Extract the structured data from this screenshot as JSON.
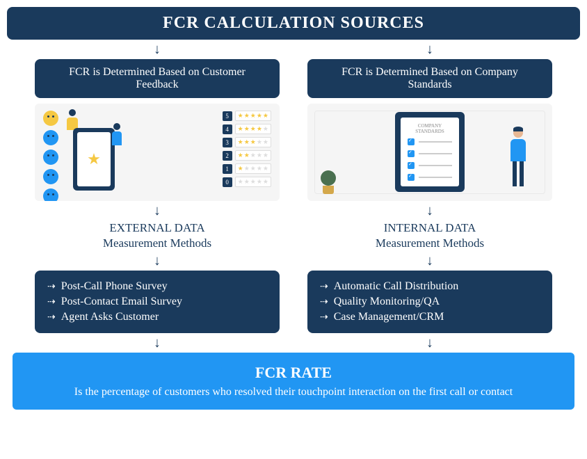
{
  "title": "FCR CALCULATION SOURCES",
  "left": {
    "source": "FCR is Determined Based on Customer Feedback",
    "heading_line1": "EXTERNAL DATA",
    "heading_line2": "Measurement Methods",
    "methods": [
      "Post-Call Phone Survey",
      "Post-Contact Email Survey",
      "Agent Asks Customer"
    ],
    "ratings": [
      "5",
      "4",
      "3",
      "2",
      "1",
      "0"
    ]
  },
  "right": {
    "source": "FCR is Determined Based on Company Standards",
    "heading_line1": "INTERNAL DATA",
    "heading_line2": "Measurement Methods",
    "methods": [
      "Automatic Call Distribution",
      "Quality Monitoring/QA",
      "Case Management/CRM"
    ],
    "clipboard_title": "COMPANY STANDARDS"
  },
  "footer": {
    "title": "FCR RATE",
    "text": "Is the percentage of customers who resolved their touchpoint interaction on the first call or contact"
  }
}
